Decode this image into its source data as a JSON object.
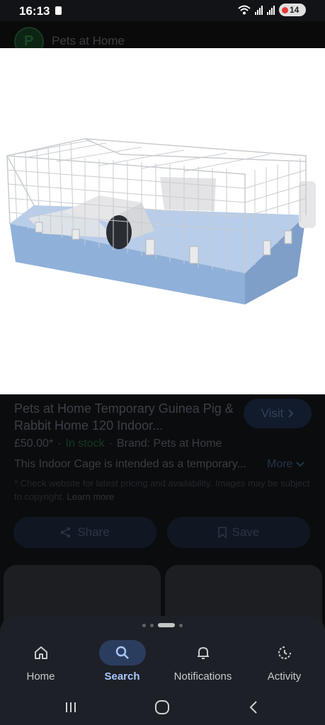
{
  "status_bar": {
    "time": "16:13",
    "battery": "14"
  },
  "source": {
    "logo_letter": "P",
    "name": "Pets at Home"
  },
  "product": {
    "title": "Pets at Home Temporary Guinea Pig & Rabbit Home 120 Indoor...",
    "visit_label": "Visit",
    "price": "£50.00*",
    "separator": "·",
    "stock": "In stock",
    "brand": "Brand: Pets at Home",
    "description": "This Indoor Cage is intended as a temporary...",
    "more_label": "More",
    "disclaimer": "* Check website for latest pricing and availability. Images may be subject to copyright.",
    "learn_more": "Learn more"
  },
  "actions": {
    "share_label": "Share",
    "save_label": "Save"
  },
  "nav": {
    "items": [
      {
        "label": "Home",
        "icon": "home-icon"
      },
      {
        "label": "Search",
        "icon": "search-icon",
        "active": true
      },
      {
        "label": "Notifications",
        "icon": "bell-icon"
      },
      {
        "label": "Activity",
        "icon": "activity-icon"
      }
    ]
  },
  "colors": {
    "accent": "#a8c7fa",
    "cage_base": "#8fb0d8",
    "in_stock": "#1e6b3a"
  }
}
